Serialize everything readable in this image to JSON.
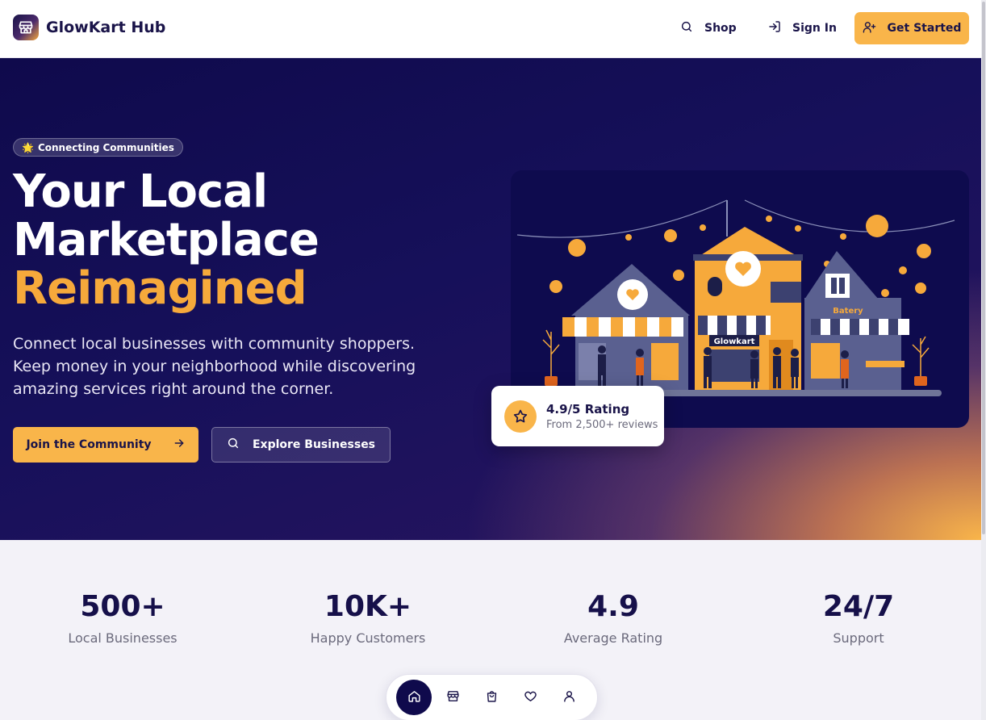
{
  "header": {
    "brand": "GlowKart Hub",
    "nav": {
      "shop": "Shop",
      "sign_in": "Sign In",
      "get_started": "Get Started"
    }
  },
  "hero": {
    "badge_emoji": "🌟",
    "badge": "Connecting Communities",
    "headline_line1": "Your Local",
    "headline_line2": "Marketplace",
    "headline_accent": "Reimagined",
    "description": "Connect local businesses with community shoppers. Keep money in your neighborhood while discovering amazing services right around the corner.",
    "primary_cta": "Join the Community",
    "secondary_cta": "Explore Businesses",
    "rating": {
      "title": "4.9/5 Rating",
      "subtitle": "From 2,500+ reviews"
    },
    "illustration": {
      "shop_sign_1": "Glowkart",
      "shop_sign_2": "Batery"
    }
  },
  "stats": [
    {
      "value": "500+",
      "label": "Local Businesses"
    },
    {
      "value": "10K+",
      "label": "Happy Customers"
    },
    {
      "value": "4.9",
      "label": "Average Rating"
    },
    {
      "value": "24/7",
      "label": "Support"
    }
  ],
  "dock": {
    "items": [
      "home-icon",
      "store-icon",
      "shopping-bag-icon",
      "heart-icon",
      "user-icon"
    ],
    "active": "home-icon"
  },
  "colors": {
    "navy": "#0f0a4c",
    "accent": "#f9b54a",
    "muted": "#6b6a7c"
  }
}
